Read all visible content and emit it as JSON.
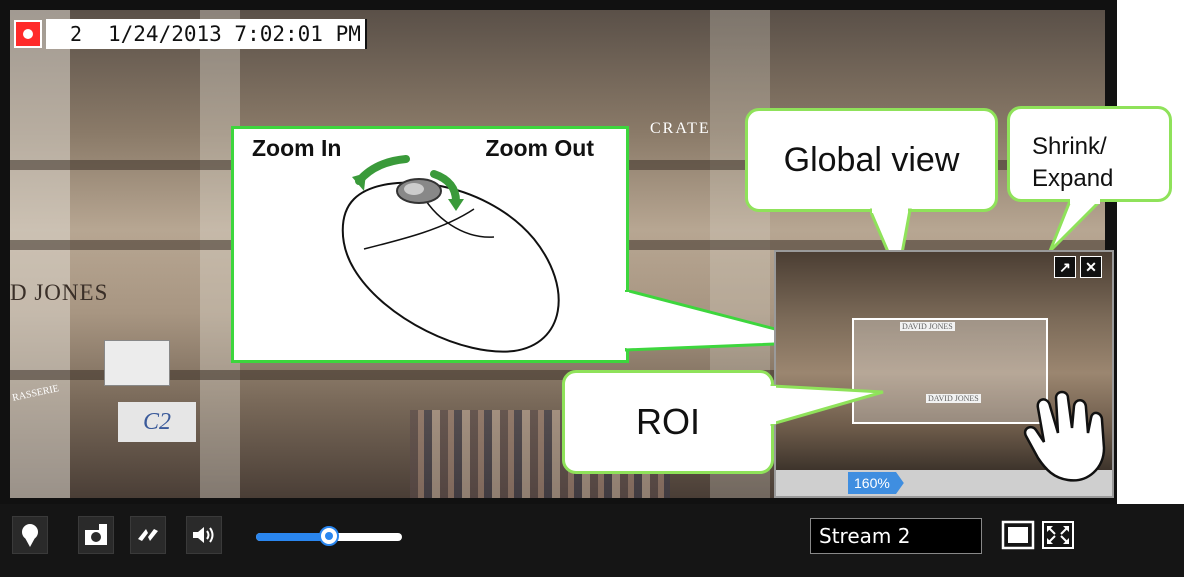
{
  "status": {
    "stream_number": "2",
    "timestamp": "1/24/2013 7:02:01 PM"
  },
  "scene": {
    "sign_store": "D JONES",
    "sign_c2": "C2",
    "sign_cafe": "CRATE",
    "sign_brasserie": "RASSERIE"
  },
  "callouts": {
    "zoom_in": "Zoom In",
    "zoom_out": "Zoom Out",
    "global_view": "Global view",
    "shrink_line1": "Shrink/",
    "shrink_line2": "Expand",
    "roi": "ROI"
  },
  "minimap": {
    "zoom_level": "160%",
    "sign_top": "DAVID JONES",
    "sign_bottom": "DAVID JONES"
  },
  "toolbar": {
    "stream_selected": "Stream 2",
    "volume_level": 0.5
  },
  "icons": [
    "record-icon",
    "marker-icon",
    "snapshot-icon",
    "audio-talk-icon",
    "volume-icon",
    "fit-window-icon",
    "fullscreen-icon",
    "expand-icon",
    "close-icon",
    "mouse-icon",
    "hand-cursor-icon"
  ],
  "colors": {
    "accent": "#2a86ef",
    "callout_border": "#8fe25a",
    "record": "#ff2a2a"
  }
}
